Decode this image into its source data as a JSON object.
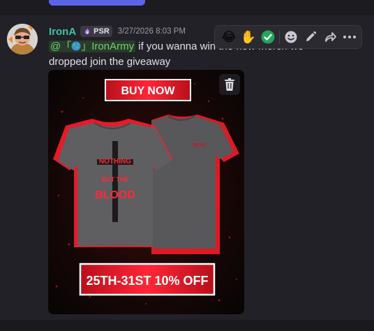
{
  "message": {
    "author": "IronA",
    "tag": "PSR",
    "timestamp": "3/27/2026 8:03 PM",
    "mention_prefix": "@「",
    "mention_suffix": "」IronArmy",
    "text": " if you wanna win the new merch we dropped join the giveaway"
  },
  "image": {
    "banner_top": "BUY NOW",
    "banner_bottom": "25TH-31ST 10% OFF",
    "shirt_text_line1": "NOTHING",
    "shirt_text_line2": "BUT THE",
    "shirt_text_line3": "BLOOD",
    "shirt_back_logo": "IRON"
  },
  "toolbar": {
    "reactions": [
      "😂",
      "✋"
    ],
    "icons": [
      "check-reaction-icon",
      "add-reaction-icon",
      "edit-icon",
      "forward-icon",
      "more-icon"
    ]
  },
  "colors": {
    "username": "#40c4a7",
    "mention_bg": "#2a3a2c",
    "mention_text": "#6fd36e",
    "banner_red": "#e11a2a",
    "check_green": "#23a55a"
  }
}
